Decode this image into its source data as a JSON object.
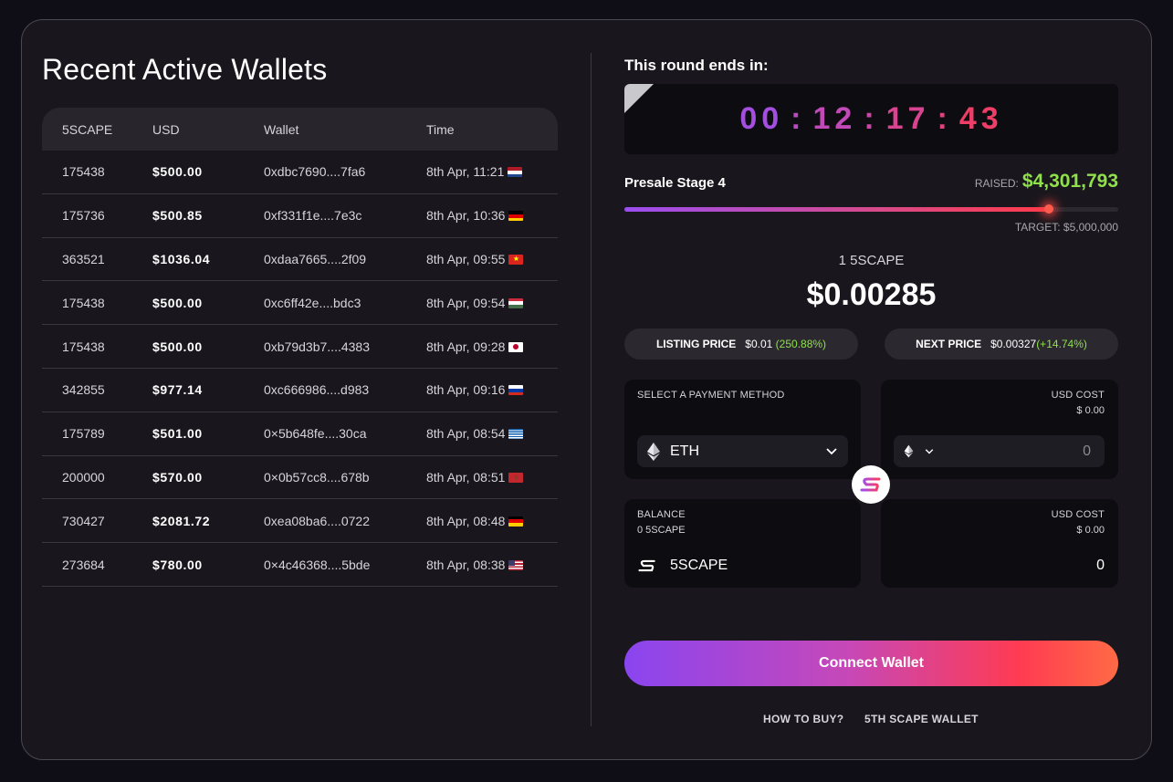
{
  "left": {
    "title": "Recent Active Wallets",
    "columns": [
      "5SCAPE",
      "USD",
      "Wallet",
      "Time"
    ],
    "rows": [
      {
        "amount": "175438",
        "usd": "$500.00",
        "wallet": "0xdbc7690....7fa6",
        "time": "8th Apr, 11:21",
        "flag": "nl"
      },
      {
        "amount": "175736",
        "usd": "$500.85",
        "wallet": "0xf331f1e....7e3c",
        "time": "8th Apr, 10:36",
        "flag": "de"
      },
      {
        "amount": "363521",
        "usd": "$1036.04",
        "wallet": "0xdaa7665....2f09",
        "time": "8th Apr, 09:55",
        "flag": "vn"
      },
      {
        "amount": "175438",
        "usd": "$500.00",
        "wallet": "0xc6ff42e....bdc3",
        "time": "8th Apr, 09:54",
        "flag": "hu"
      },
      {
        "amount": "175438",
        "usd": "$500.00",
        "wallet": "0xb79d3b7....4383",
        "time": "8th Apr, 09:28",
        "flag": "jp"
      },
      {
        "amount": "342855",
        "usd": "$977.14",
        "wallet": "0xc666986....d983",
        "time": "8th Apr, 09:16",
        "flag": "ru"
      },
      {
        "amount": "175789",
        "usd": "$501.00",
        "wallet": "0×5b648fe....30ca",
        "time": "8th Apr, 08:54",
        "flag": "gr"
      },
      {
        "amount": "200000",
        "usd": "$570.00",
        "wallet": "0×0b57cc8....678b",
        "time": "8th Apr, 08:51",
        "flag": "ma"
      },
      {
        "amount": "730427",
        "usd": "$2081.72",
        "wallet": "0xea08ba6....0722",
        "time": "8th Apr, 08:48",
        "flag": "de"
      },
      {
        "amount": "273684",
        "usd": "$780.00",
        "wallet": "0×4c46368....5bde",
        "time": "8th Apr, 08:38",
        "flag": "us"
      }
    ]
  },
  "right": {
    "round_label": "This round ends in:",
    "timer": {
      "d": "00",
      "h": "12",
      "m": "17",
      "s": "43",
      "sep": ":"
    },
    "stage": "Presale Stage 4",
    "raised_label": "RAISED:",
    "raised_value": "$4,301,793",
    "progress_fraction": 0.86,
    "target": "TARGET: $5,000,000",
    "unit": "1 5SCAPE",
    "price": "$0.00285",
    "listing": {
      "label": "LISTING PRICE",
      "value": "$0.01",
      "gain": "(250.88%)"
    },
    "next": {
      "label": "NEXT PRICE",
      "value": "$0.00327",
      "gain": "(+14.74%)"
    },
    "pay_panel": {
      "label": "SELECT A PAYMENT METHOD",
      "selected": "ETH"
    },
    "cost_panel_1": {
      "label": "USD COST",
      "value": "$ 0.00",
      "amount": "0"
    },
    "balance_panel": {
      "label": "BALANCE",
      "value": "0 5SCAPE",
      "token": "5SCAPE"
    },
    "cost_panel_2": {
      "label": "USD COST",
      "value": "$ 0.00",
      "amount": "0"
    },
    "connect_label": "Connect Wallet",
    "links": [
      "HOW TO BUY?",
      "5TH SCAPE WALLET"
    ]
  },
  "colors": {
    "accent_green": "#8fe04a",
    "gradient_start": "#8a45f0",
    "gradient_end": "#ff6a45",
    "timer_pink": "#e83e6c",
    "timer_purple": "#a44ee0"
  }
}
